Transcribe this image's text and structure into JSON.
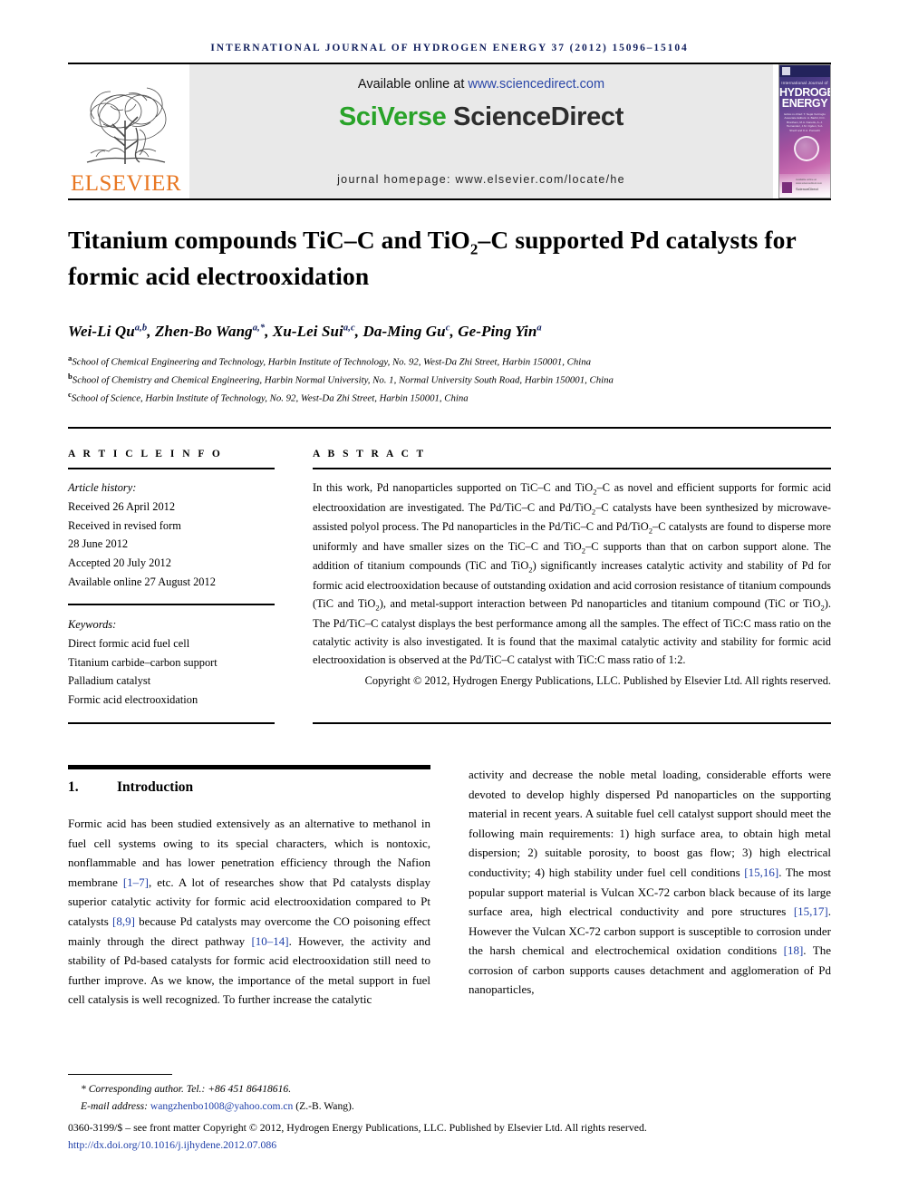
{
  "running_head": "INTERNATIONAL JOURNAL OF HYDROGEN ENERGY 37 (2012) 15096–15104",
  "banner": {
    "available_text": "Available online at ",
    "available_url": "www.sciencedirect.com",
    "brand_sci": "SciVerse",
    "brand_sd": " ScienceDirect",
    "homepage": "journal homepage: www.elsevier.com/locate/he",
    "publisher_word": "ELSEVIER",
    "publisher_color": "#e87722",
    "brand_green": "#29a329",
    "link_blue": "#2b47a8"
  },
  "cover": {
    "line_ij": "International Journal of",
    "line_h1": "HYDROGEN",
    "line_h2": "ENERGY",
    "editors": "Editor-in-Chief: T. Nejat Veziroglu\nAssociate Editors: A. Barbir, D.C. Branham, M.A. Kanetis,\nA.-J. Hernandez, J.M. Ogden,\nS.A. Sherif and K.A. Pomachi",
    "sd_label": "ScienceDirect",
    "sd_note": "Available online at www.sciencedirect.com"
  },
  "title_parts": {
    "a": "Titanium compounds TiC",
    "dash1": "–",
    "b": "C and TiO",
    "sub": "2",
    "dash2": "–",
    "c": "C supported Pd catalysts for formic acid electrooxidation"
  },
  "authors": [
    {
      "name": "Wei-Li Qu",
      "sup": "a,b",
      "sep": ", "
    },
    {
      "name": "Zhen-Bo Wang",
      "sup": "a,*",
      "sep": ", "
    },
    {
      "name": "Xu-Lei Sui",
      "sup": "a,c",
      "sep": ", "
    },
    {
      "name": "Da-Ming Gu",
      "sup": "c",
      "sep": ", "
    },
    {
      "name": "Ge-Ping Yin",
      "sup": "a",
      "sep": ""
    }
  ],
  "affiliations": [
    {
      "marker": "a",
      "text": "School of Chemical Engineering and Technology, Harbin Institute of Technology, No. 92, West-Da Zhi Street, Harbin 150001, China"
    },
    {
      "marker": "b",
      "text": "School of Chemistry and Chemical Engineering, Harbin Normal University, No. 1, Normal University South Road, Harbin 150001, China"
    },
    {
      "marker": "c",
      "text": "School of Science, Harbin Institute of Technology, No. 92, West-Da Zhi Street, Harbin 150001, China"
    }
  ],
  "article_info": {
    "heading": "A R T I C L E  I N F O",
    "history_label": "Article history:",
    "history": [
      "Received 26 April 2012",
      "Received in revised form",
      "28 June 2012",
      "Accepted 20 July 2012",
      "Available online 27 August 2012"
    ],
    "keywords_label": "Keywords:",
    "keywords": [
      "Direct formic acid fuel cell",
      "Titanium carbide–carbon support",
      "Palladium catalyst",
      "Formic acid electrooxidation"
    ]
  },
  "abstract": {
    "heading": "A B S T R A C T",
    "body_1": "In this work, Pd nanoparticles supported on TiC–C and TiO",
    "body_1b": "–C as novel and efficient supports for formic acid electrooxidation are investigated. The Pd/TiC–C and Pd/TiO",
    "body_1c": "–C catalysts have been synthesized by microwave-assisted polyol process. The Pd nanoparticles in the Pd/TiC–C and Pd/TiO",
    "body_1d": "–C catalysts are found to disperse more uniformly and have smaller sizes on the TiC–C and TiO",
    "body_1e": "–C supports than that on carbon support alone. The addition of titanium compounds (TiC and TiO",
    "body_1f": ") significantly increases catalytic activity and stability of Pd for formic acid electrooxidation because of outstanding oxidation and acid corrosion resistance of titanium compounds (TiC and TiO",
    "body_1g": "), and metal-support interaction between Pd nanoparticles and titanium compound (TiC or TiO",
    "body_1h": "). The Pd/TiC–C catalyst displays the best performance among all the samples. The effect of TiC:C mass ratio on the catalytic activity is also investigated. It is found that the maximal catalytic activity and stability for formic acid electrooxidation is observed at the Pd/TiC–C catalyst with TiC:C mass ratio of 1:2.",
    "sub": "2",
    "copyright": "Copyright © 2012, Hydrogen Energy Publications, LLC. Published by Elsevier Ltd. All rights reserved."
  },
  "section": {
    "number": "1.",
    "title": "Introduction"
  },
  "body": {
    "left_1": "Formic acid has been studied extensively as an alternative to methanol in fuel cell systems owing to its special characters, which is nontoxic, nonflammable and has lower penetration efficiency through the Nafion membrane ",
    "cite_1": "[1–7]",
    "left_2": ", etc. A lot of researches show that Pd catalysts display superior catalytic activity for formic acid electrooxidation compared to Pt catalysts ",
    "cite_2": "[8,9]",
    "left_3": " because Pd catalysts may overcome the CO poisoning effect mainly through the direct pathway ",
    "cite_3": "[10–14]",
    "left_4": ". However, the activity and stability of Pd-based catalysts for formic acid electrooxidation still need to further improve. As we know, the importance of the metal support in fuel cell catalysis is well recognized. To further increase the catalytic",
    "right_1": "activity and decrease the noble metal loading, considerable efforts were devoted to develop highly dispersed Pd nanoparticles on the supporting material in recent years. A suitable fuel cell catalyst support should meet the following main requirements: 1) high surface area, to obtain high metal dispersion; 2) suitable porosity, to boost gas flow; 3) high electrical conductivity; 4) high stability under fuel cell conditions ",
    "cite_4": "[15,16]",
    "right_2": ". The most popular support material is Vulcan XC-72 carbon black because of its large surface area, high electrical conductivity and pore structures ",
    "cite_5": "[15,17]",
    "right_3": ". However the Vulcan XC-72 carbon support is susceptible to corrosion under the harsh chemical and electrochemical oxidation conditions ",
    "cite_6": "[18]",
    "right_4": ". The corrosion of carbon supports causes detachment and agglomeration of Pd nanoparticles,"
  },
  "footer": {
    "corresponding": "* Corresponding author. Tel.: +86 451 86418616.",
    "email_label": "E-mail address: ",
    "email": "wangzhenbo1008@yahoo.com.cn",
    "email_suffix": " (Z.-B. Wang).",
    "issn_line": "0360-3199/$ – see front matter Copyright © 2012, Hydrogen Energy Publications, LLC. Published by Elsevier Ltd. All rights reserved.",
    "doi": "http://dx.doi.org/10.1016/j.ijhydene.2012.07.086"
  }
}
